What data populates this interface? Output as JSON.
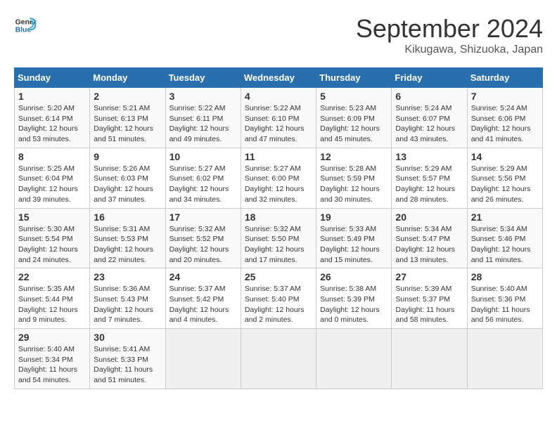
{
  "header": {
    "logo_line1": "General",
    "logo_line2": "Blue",
    "month_title": "September 2024",
    "subtitle": "Kikugawa, Shizuoka, Japan"
  },
  "days_of_week": [
    "Sunday",
    "Monday",
    "Tuesday",
    "Wednesday",
    "Thursday",
    "Friday",
    "Saturday"
  ],
  "weeks": [
    [
      {
        "day": "1",
        "sunrise": "5:20 AM",
        "sunset": "6:14 PM",
        "daylight": "12 hours and 53 minutes."
      },
      {
        "day": "2",
        "sunrise": "5:21 AM",
        "sunset": "6:13 PM",
        "daylight": "12 hours and 51 minutes."
      },
      {
        "day": "3",
        "sunrise": "5:22 AM",
        "sunset": "6:11 PM",
        "daylight": "12 hours and 49 minutes."
      },
      {
        "day": "4",
        "sunrise": "5:22 AM",
        "sunset": "6:10 PM",
        "daylight": "12 hours and 47 minutes."
      },
      {
        "day": "5",
        "sunrise": "5:23 AM",
        "sunset": "6:09 PM",
        "daylight": "12 hours and 45 minutes."
      },
      {
        "day": "6",
        "sunrise": "5:24 AM",
        "sunset": "6:07 PM",
        "daylight": "12 hours and 43 minutes."
      },
      {
        "day": "7",
        "sunrise": "5:24 AM",
        "sunset": "6:06 PM",
        "daylight": "12 hours and 41 minutes."
      }
    ],
    [
      {
        "day": "8",
        "sunrise": "5:25 AM",
        "sunset": "6:04 PM",
        "daylight": "12 hours and 39 minutes."
      },
      {
        "day": "9",
        "sunrise": "5:26 AM",
        "sunset": "6:03 PM",
        "daylight": "12 hours and 37 minutes."
      },
      {
        "day": "10",
        "sunrise": "5:27 AM",
        "sunset": "6:02 PM",
        "daylight": "12 hours and 34 minutes."
      },
      {
        "day": "11",
        "sunrise": "5:27 AM",
        "sunset": "6:00 PM",
        "daylight": "12 hours and 32 minutes."
      },
      {
        "day": "12",
        "sunrise": "5:28 AM",
        "sunset": "5:59 PM",
        "daylight": "12 hours and 30 minutes."
      },
      {
        "day": "13",
        "sunrise": "5:29 AM",
        "sunset": "5:57 PM",
        "daylight": "12 hours and 28 minutes."
      },
      {
        "day": "14",
        "sunrise": "5:29 AM",
        "sunset": "5:56 PM",
        "daylight": "12 hours and 26 minutes."
      }
    ],
    [
      {
        "day": "15",
        "sunrise": "5:30 AM",
        "sunset": "5:54 PM",
        "daylight": "12 hours and 24 minutes."
      },
      {
        "day": "16",
        "sunrise": "5:31 AM",
        "sunset": "5:53 PM",
        "daylight": "12 hours and 22 minutes."
      },
      {
        "day": "17",
        "sunrise": "5:32 AM",
        "sunset": "5:52 PM",
        "daylight": "12 hours and 20 minutes."
      },
      {
        "day": "18",
        "sunrise": "5:32 AM",
        "sunset": "5:50 PM",
        "daylight": "12 hours and 17 minutes."
      },
      {
        "day": "19",
        "sunrise": "5:33 AM",
        "sunset": "5:49 PM",
        "daylight": "12 hours and 15 minutes."
      },
      {
        "day": "20",
        "sunrise": "5:34 AM",
        "sunset": "5:47 PM",
        "daylight": "12 hours and 13 minutes."
      },
      {
        "day": "21",
        "sunrise": "5:34 AM",
        "sunset": "5:46 PM",
        "daylight": "12 hours and 11 minutes."
      }
    ],
    [
      {
        "day": "22",
        "sunrise": "5:35 AM",
        "sunset": "5:44 PM",
        "daylight": "12 hours and 9 minutes."
      },
      {
        "day": "23",
        "sunrise": "5:36 AM",
        "sunset": "5:43 PM",
        "daylight": "12 hours and 7 minutes."
      },
      {
        "day": "24",
        "sunrise": "5:37 AM",
        "sunset": "5:42 PM",
        "daylight": "12 hours and 4 minutes."
      },
      {
        "day": "25",
        "sunrise": "5:37 AM",
        "sunset": "5:40 PM",
        "daylight": "12 hours and 2 minutes."
      },
      {
        "day": "26",
        "sunrise": "5:38 AM",
        "sunset": "5:39 PM",
        "daylight": "12 hours and 0 minutes."
      },
      {
        "day": "27",
        "sunrise": "5:39 AM",
        "sunset": "5:37 PM",
        "daylight": "11 hours and 58 minutes."
      },
      {
        "day": "28",
        "sunrise": "5:40 AM",
        "sunset": "5:36 PM",
        "daylight": "11 hours and 56 minutes."
      }
    ],
    [
      {
        "day": "29",
        "sunrise": "5:40 AM",
        "sunset": "5:34 PM",
        "daylight": "11 hours and 54 minutes."
      },
      {
        "day": "30",
        "sunrise": "5:41 AM",
        "sunset": "5:33 PM",
        "daylight": "11 hours and 51 minutes."
      },
      {
        "day": "",
        "sunrise": "",
        "sunset": "",
        "daylight": ""
      },
      {
        "day": "",
        "sunrise": "",
        "sunset": "",
        "daylight": ""
      },
      {
        "day": "",
        "sunrise": "",
        "sunset": "",
        "daylight": ""
      },
      {
        "day": "",
        "sunrise": "",
        "sunset": "",
        "daylight": ""
      },
      {
        "day": "",
        "sunrise": "",
        "sunset": "",
        "daylight": ""
      }
    ]
  ]
}
